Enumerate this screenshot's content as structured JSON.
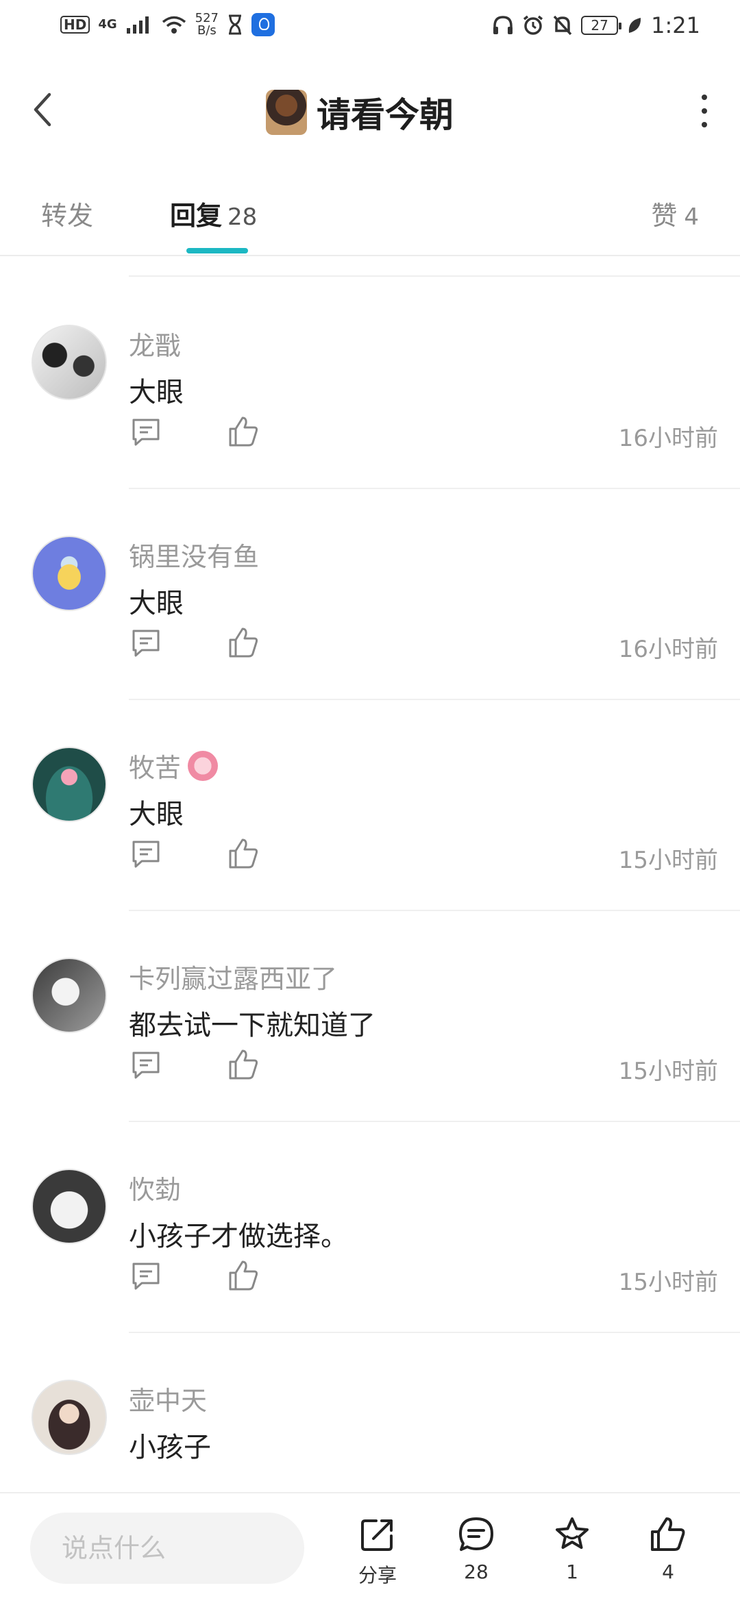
{
  "status_bar": {
    "hd": "HD",
    "network": "4G",
    "speed_value": "527",
    "speed_unit": "B/s",
    "battery": "27",
    "time": "1:21"
  },
  "header": {
    "title": "请看今朝"
  },
  "tabs": {
    "repost": "转发",
    "reply": "回复",
    "reply_count": "28",
    "likes": "赞",
    "likes_count": "4"
  },
  "comments": [
    {
      "user": "龙戬",
      "text": "大眼",
      "time": "16小时前",
      "badge": false
    },
    {
      "user": "锅里没有鱼",
      "text": "大眼",
      "time": "16小时前",
      "badge": false
    },
    {
      "user": "牧苦",
      "text": "大眼",
      "time": "15小时前",
      "badge": true
    },
    {
      "user": "卡列赢过露西亚了",
      "text": "都去试一下就知道了",
      "time": "15小时前",
      "badge": false
    },
    {
      "user": "忺勎",
      "text": "小孩子才做选择。",
      "time": "15小时前",
      "badge": false
    },
    {
      "user": "壶中天",
      "text": "小孩子",
      "time": "",
      "badge": false
    }
  ],
  "bottom_bar": {
    "input_placeholder": "说点什么",
    "share_label": "分享",
    "comment_count": "28",
    "favorite_count": "1",
    "like_count": "4"
  },
  "colors": {
    "accent": "#1cb8c3",
    "muted_text": "#9a9a9a"
  }
}
